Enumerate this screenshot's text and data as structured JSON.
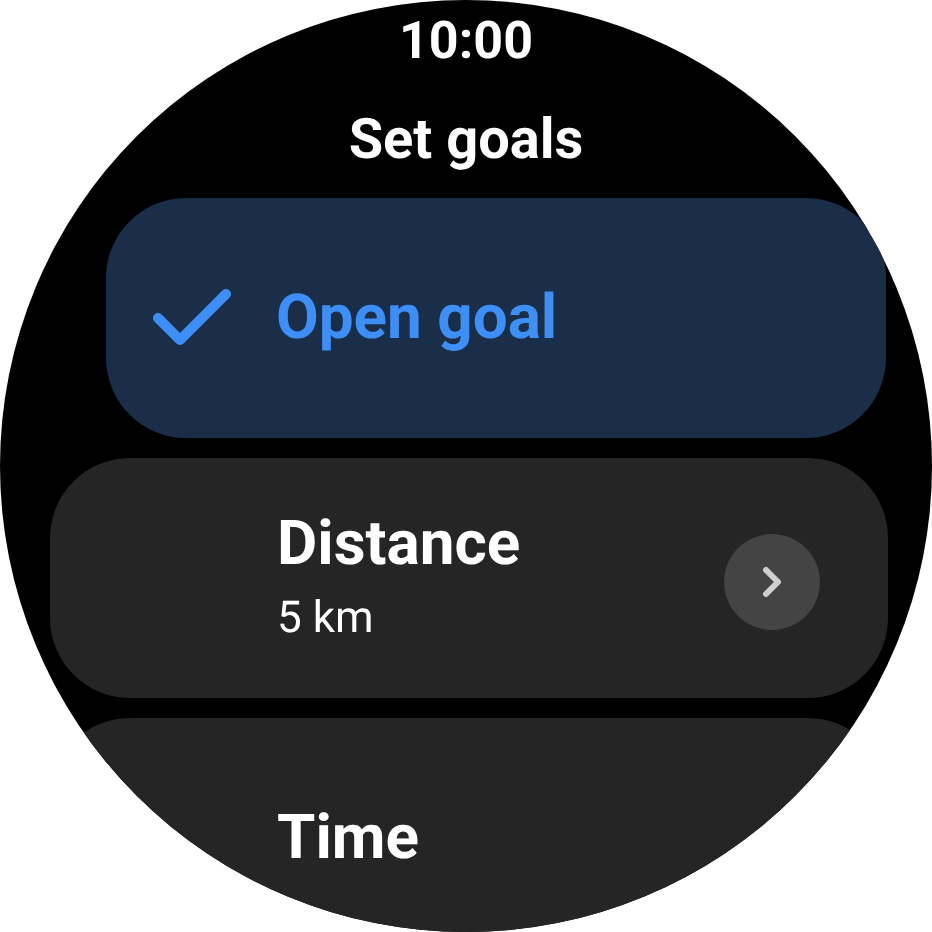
{
  "status_bar": {
    "time": "10:00"
  },
  "title": "Set goals",
  "goals": [
    {
      "label": "Open goal",
      "selected": true
    },
    {
      "label": "Distance",
      "value": "5 km",
      "selected": false
    },
    {
      "label": "Time",
      "selected": false
    }
  ]
}
